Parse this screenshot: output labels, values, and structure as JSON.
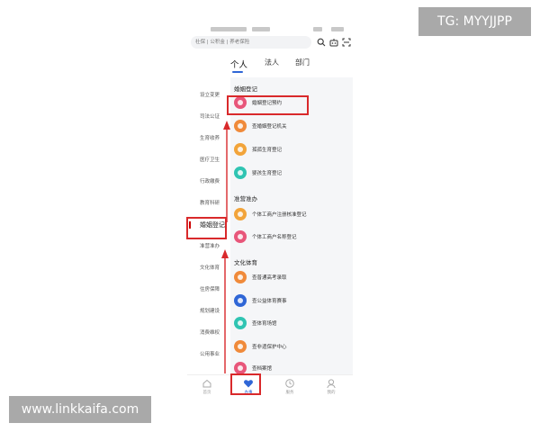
{
  "watermarks": {
    "top_right": "TG: MYYJJPP",
    "bottom_left": "www.linkkaifa.com"
  },
  "search": {
    "placeholder": "社保 | 公积金 | 养老保险"
  },
  "tabs": [
    {
      "label": "个人",
      "active": true
    },
    {
      "label": "法人",
      "active": false
    },
    {
      "label": "部门",
      "active": false
    }
  ],
  "sidebar": {
    "items": [
      {
        "label": "设立变更"
      },
      {
        "label": "司法公证"
      },
      {
        "label": "生育收养"
      },
      {
        "label": "医疗卫生"
      },
      {
        "label": "行政缴费"
      },
      {
        "label": "教育科研"
      },
      {
        "label": "婚姻登记",
        "active": true
      },
      {
        "label": "准营准办"
      },
      {
        "label": "文化体育"
      },
      {
        "label": "住房保障"
      },
      {
        "label": "规划建设"
      },
      {
        "label": "消费维权"
      },
      {
        "label": "公用事业"
      }
    ]
  },
  "sections": [
    {
      "title": "婚姻登记",
      "items": [
        {
          "label": "婚姻登记预约",
          "icon": "marriage-booking-icon",
          "color": "#e8567a"
        },
        {
          "label": "查婚姻登记机关",
          "icon": "marriage-office-icon",
          "color": "#f08a3a"
        },
        {
          "label": "孤孤生育登记",
          "icon": "birth-registration-icon",
          "color": "#f2a43a"
        },
        {
          "label": "婴孩生育登记",
          "icon": "baby-registration-icon",
          "color": "#2fc4b2"
        }
      ]
    },
    {
      "title": "准营准办",
      "items": [
        {
          "label": "个体工商户注册核准登记",
          "icon": "business-registration-icon",
          "color": "#f2a43a"
        },
        {
          "label": "个体工商户名称登记",
          "icon": "business-name-icon",
          "color": "#e8567a"
        }
      ]
    },
    {
      "title": "文化体育",
      "items": [
        {
          "label": "查普通高考录取",
          "icon": "exam-admission-icon",
          "color": "#f08a3a"
        },
        {
          "label": "查公益体育赛事",
          "icon": "sports-event-icon",
          "color": "#2f66d6"
        },
        {
          "label": "查体育场馆",
          "icon": "stadium-icon",
          "color": "#2fc4b2"
        },
        {
          "label": "查非遗保护中心",
          "icon": "heritage-center-icon",
          "color": "#f08a3a"
        },
        {
          "label": "查档案馆",
          "icon": "archive-icon",
          "color": "#e8567a"
        }
      ]
    }
  ],
  "bottom_nav": [
    {
      "label": "首页",
      "icon": "home-icon",
      "active": false
    },
    {
      "label": "办事",
      "icon": "heart-icon",
      "active": true
    },
    {
      "label": "服务",
      "icon": "clock-icon",
      "active": false
    },
    {
      "label": "我的",
      "icon": "user-icon",
      "active": false
    }
  ],
  "colors": {
    "accent": "#2f66d6",
    "annotation": "#d9292b"
  }
}
